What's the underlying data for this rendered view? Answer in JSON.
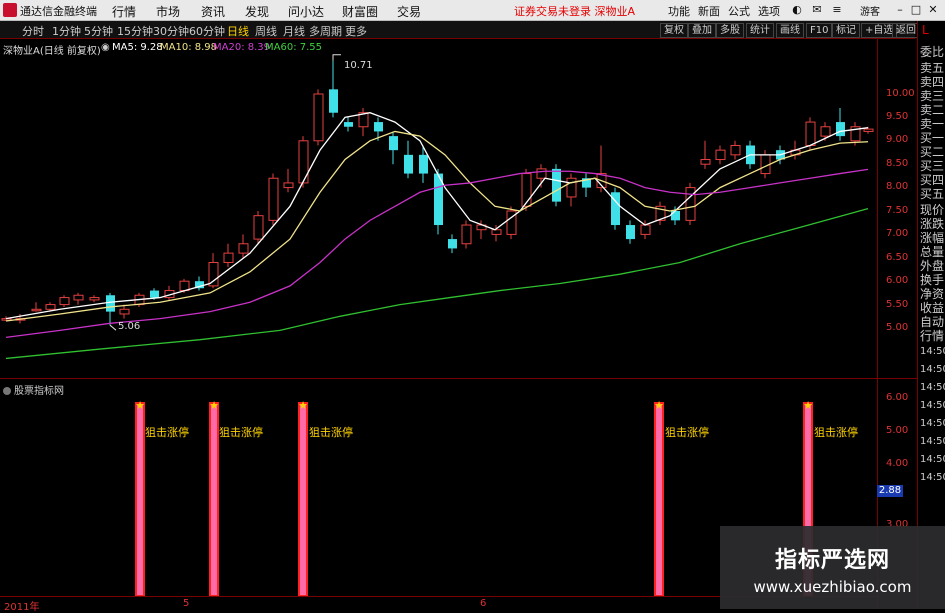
{
  "titlebar": {
    "app_name": "通达信金融终端",
    "menus": [
      "行情",
      "市场",
      "资讯",
      "发现",
      "问小达",
      "财富圈",
      "交易"
    ],
    "alert": "证券交易未登录  深物业A",
    "right_items": [
      "功能",
      "新面",
      "公式",
      "选项"
    ],
    "games": "游客",
    "win_min": "–",
    "win_max": "□",
    "win_close": "✕"
  },
  "toolbar": {
    "items": [
      "分时",
      "1分钟",
      "5分钟",
      "15分钟",
      "30分钟",
      "60分钟",
      "日线",
      "周线",
      "月线",
      "多周期",
      "更多"
    ],
    "active_index": 6,
    "right_tools": [
      "复权",
      "叠加",
      "多股",
      "统计",
      "画线",
      "F10",
      "标记",
      "+自选",
      "返回"
    ]
  },
  "chart": {
    "stock_title": "深物业A(日线 前复权)",
    "ma5": "MA5: 9.28",
    "ma10": "MA10: 8.98",
    "ma20": "MA20: 8.39",
    "ma60": "MA60: 7.55",
    "ma5_color": "#ffffff",
    "ma10_color": "#f0e38a",
    "ma20_color": "#c832c8",
    "ma60_color": "#30c030",
    "high_mark": "10.71",
    "low_mark": "5.06",
    "yaxis": [
      "10.00",
      "9.50",
      "9.00",
      "8.50",
      "8.00",
      "7.50",
      "7.00",
      "6.50",
      "6.00",
      "5.50",
      "5.00"
    ]
  },
  "indicator": {
    "title": "股票指标网",
    "signal_label": "狙击涨停",
    "yaxis": [
      "6.00",
      "5.00",
      "4.00",
      "3.00"
    ],
    "current_value": "2.88"
  },
  "bottom_axis": [
    "2011年",
    "5",
    "6"
  ],
  "side_panel": {
    "top_letter": "L",
    "labels": [
      "委比",
      "卖五",
      "卖四",
      "卖三",
      "卖二",
      "卖一",
      "买一",
      "买二",
      "买三",
      "买四",
      "买五",
      "现价",
      "涨跌",
      "涨幅",
      "总量",
      "外盘",
      "换手",
      "净资",
      "收益",
      "自动",
      "行情",
      "14:50",
      "14:50",
      "14:50",
      "14:50",
      "14:50",
      "14:50",
      "14:50",
      "14:50"
    ]
  },
  "watermark": {
    "title": "指标严选网",
    "url": "www.xuezhibiao.com"
  }
}
